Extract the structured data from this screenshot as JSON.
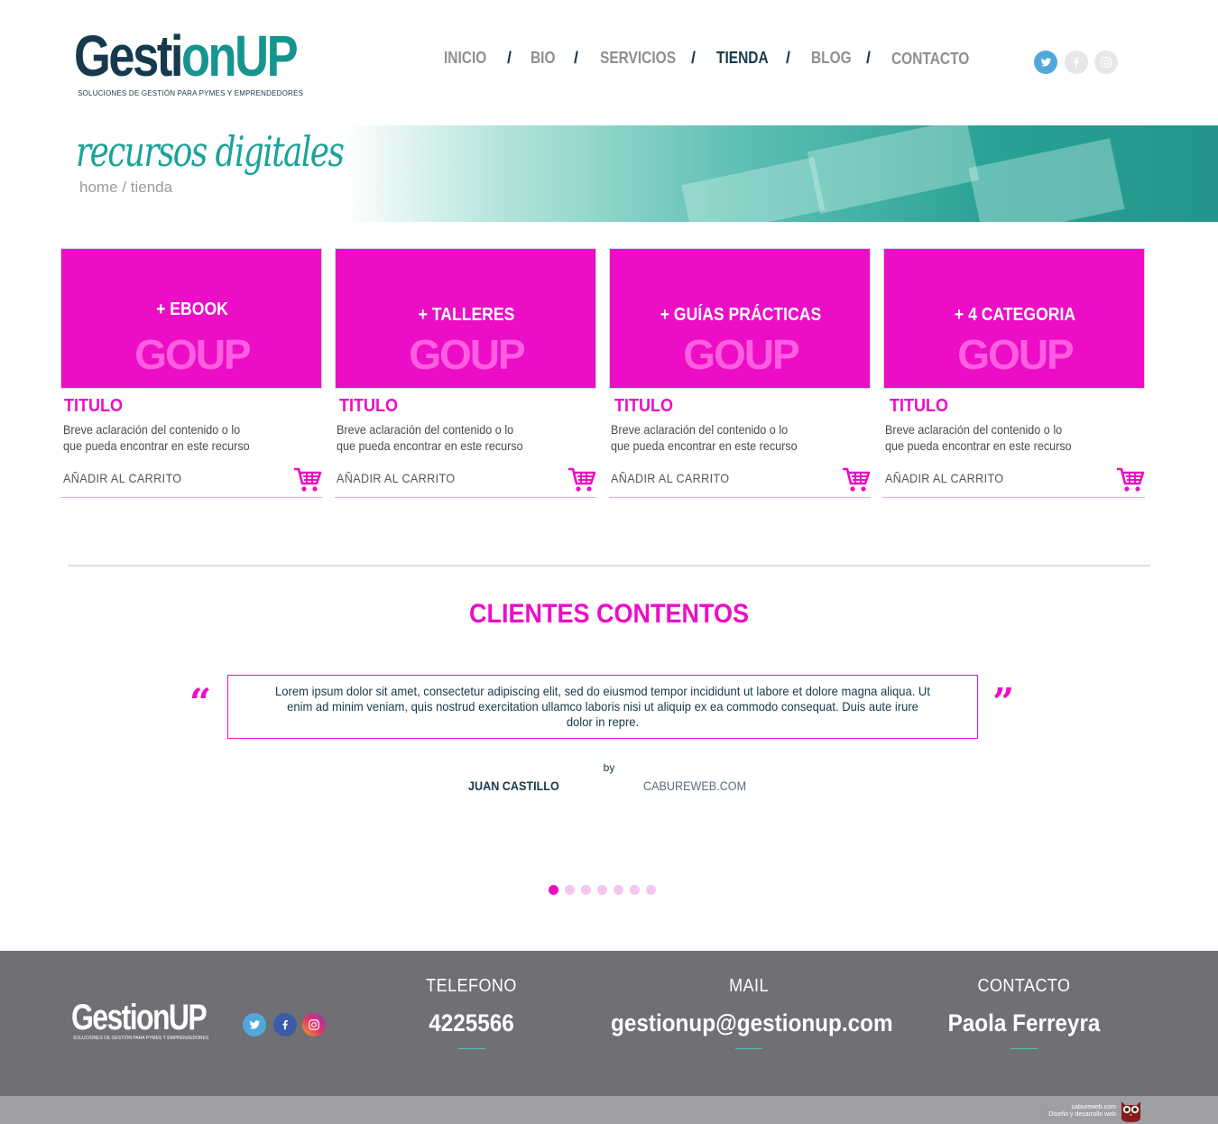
{
  "brand": {
    "logo_dark": "Gesti",
    "logo_teal": "nUP",
    "logo_bulb": "o",
    "tagline": "SOLUCIONES DE GESTIÓN PARA PYMES Y EMPRENDEDORES"
  },
  "nav": {
    "items": [
      {
        "label": "INICIO"
      },
      {
        "label": "BIO"
      },
      {
        "label": "SERVICIOS"
      },
      {
        "label": "TIENDA",
        "active": true
      },
      {
        "label": "BLOG"
      },
      {
        "label": "CONTACTO"
      }
    ],
    "separator": "/"
  },
  "social": {
    "icons": [
      "twitter-icon",
      "facebook-icon",
      "instagram-icon"
    ]
  },
  "banner": {
    "title": "recursos digitales",
    "breadcrumb_home": "home",
    "breadcrumb_sep": "/",
    "breadcrumb_current": "tienda"
  },
  "products": [
    {
      "category": "+ EBOOK",
      "mark": "GOUP",
      "title": "TITULO",
      "description": "Breve aclaración del contenido o lo que pueda encontrar en este recurso",
      "cta": "AÑADIR AL CARRITO"
    },
    {
      "category": "+ TALLERES",
      "mark": "GOUP",
      "title": "TITULO",
      "description": "Breve aclaración del contenido o lo que pueda encontrar en este recurso",
      "cta": "AÑADIR AL CARRITO"
    },
    {
      "category": "+ GUÍAS PRÁCTICAS",
      "mark": "GOUP",
      "title": "TITULO",
      "description": "Breve aclaración del contenido o lo que pueda encontrar en este recurso",
      "cta": "AÑADIR AL CARRITO"
    },
    {
      "category": "+  4 CATEGORIA",
      "mark": "GOUP",
      "title": "TITULO",
      "description": "Breve aclaración del contenido o lo que pueda encontrar en este recurso",
      "cta": "AÑADIR AL CARRITO"
    }
  ],
  "testimonials": {
    "title": "CLIENTES CONTENTOS",
    "open_quote": "“",
    "close_quote": "”",
    "text": "Lorem ipsum dolor sit amet, consectetur adipiscing elit, sed do eiusmod tempor incididunt ut labore et dolore magna aliqua. Ut enim ad minim veniam, quis nostrud exercitation ullamco laboris nisi ut aliquip ex ea commodo consequat. Duis aute irure dolor in repre.",
    "by": "by",
    "author": "JUAN CASTILLO",
    "company": "CABUREWEB.COM",
    "slides_total": 7,
    "active_slide": 1
  },
  "footer": {
    "logo": "GestionUP",
    "tagline": "SOLUCIONES DE GESTIÓN PARA PYMES Y EMPRENDEDORES",
    "phone_label": "TELEFONO",
    "phone": "4225566",
    "mail_label": "MAIL",
    "mail": "gestionup@gestionup.com",
    "contact_label": "CONTACTO",
    "contact": "Paola Ferreyra",
    "credit_line1": "cabureweb.com",
    "credit_line2": "Diseño y desarrollo web"
  },
  "colors": {
    "accent": "#ec0dc6",
    "navy": "#163a4d",
    "teal": "#16958f",
    "footer": "#6f6f74"
  }
}
